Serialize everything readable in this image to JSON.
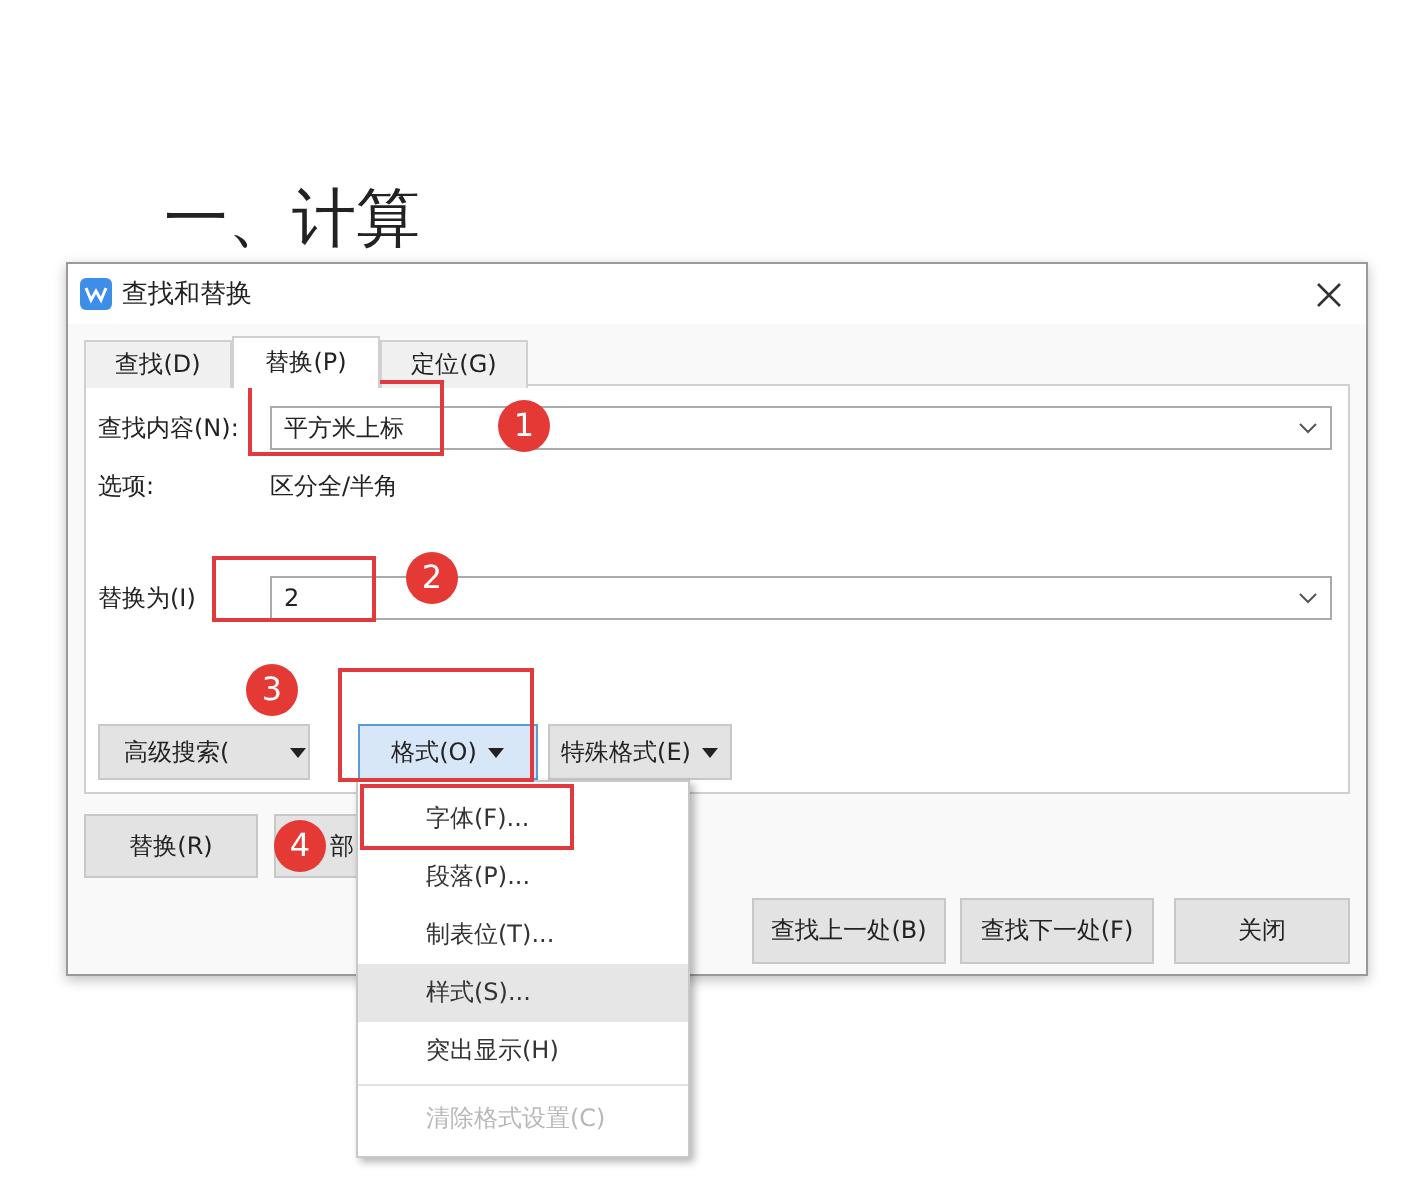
{
  "heading": "一、计算",
  "dialog": {
    "title": "查找和替换",
    "tabs": [
      {
        "label": "查找(D)",
        "selected": false
      },
      {
        "label": "替换(P)",
        "selected": true
      },
      {
        "label": "定位(G)",
        "selected": false
      }
    ],
    "find": {
      "label": "查找内容(N):",
      "value": "平方米上标"
    },
    "options": {
      "label": "选项:",
      "value": "区分全/半角"
    },
    "replace": {
      "label": "替换为(I)",
      "value": "2"
    },
    "option_buttons": [
      {
        "label": "高级搜索(",
        "active": false
      },
      {
        "label": "格式(O)",
        "active": true
      },
      {
        "label": "特殊格式(E)",
        "active": false
      }
    ],
    "action_buttons": [
      "替换(R)",
      "部"
    ],
    "bottom_buttons": [
      "查找上一处(B)",
      "查找下一处(F)",
      "关闭"
    ]
  },
  "menu": [
    {
      "label": "字体(F)...",
      "selected": false,
      "disabled": false
    },
    {
      "label": "段落(P)...",
      "selected": false,
      "disabled": false
    },
    {
      "label": "制表位(T)...",
      "selected": false,
      "disabled": false
    },
    {
      "label": "样式(S)...",
      "selected": true,
      "disabled": false
    },
    {
      "label": "突出显示(H)",
      "selected": false,
      "disabled": false
    },
    {
      "label": "清除格式设置(C)",
      "selected": false,
      "disabled": true
    }
  ],
  "markers": [
    "1",
    "2",
    "3",
    "4"
  ]
}
